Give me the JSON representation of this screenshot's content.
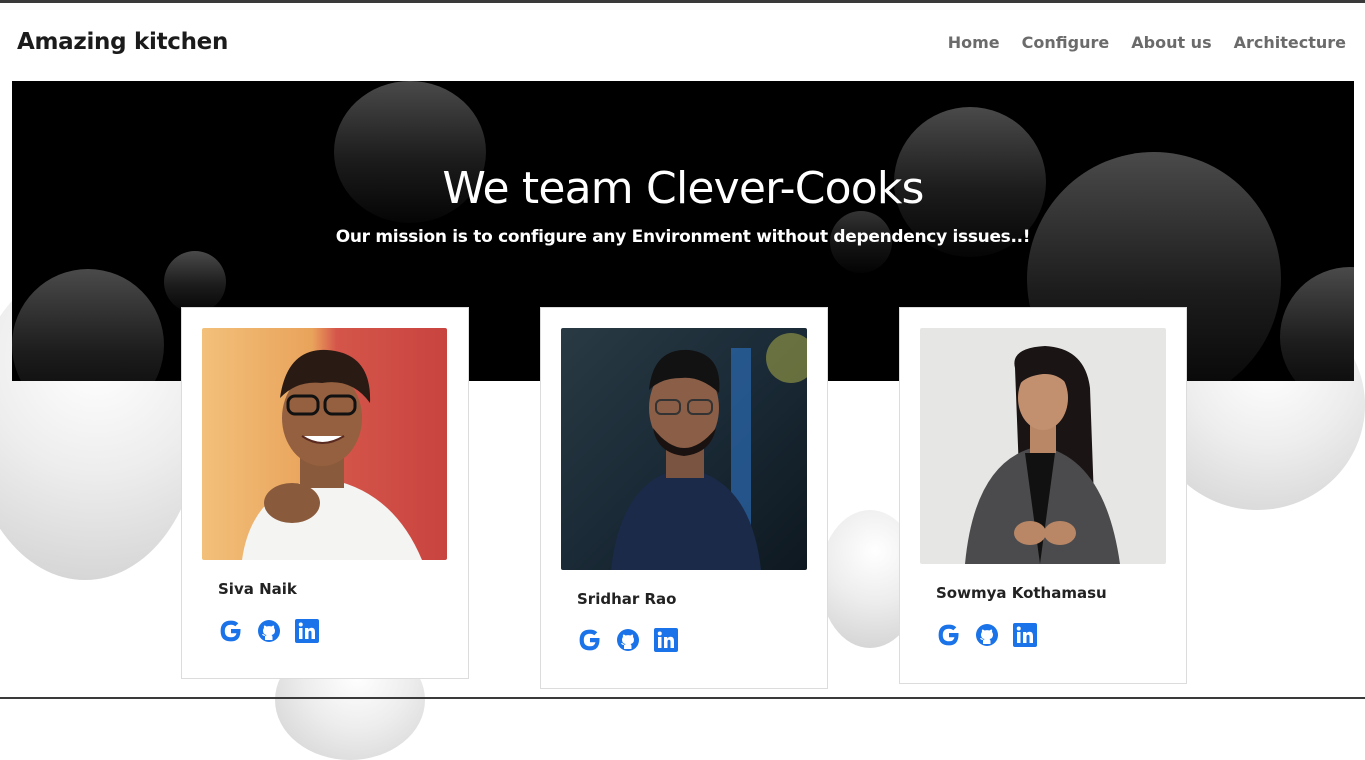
{
  "brand": {
    "title": "Amazing kitchen"
  },
  "nav": {
    "items": [
      {
        "label": "Home"
      },
      {
        "label": "Configure"
      },
      {
        "label": "About us"
      },
      {
        "label": "Architecture"
      }
    ]
  },
  "hero": {
    "title": "We team Clever-Cooks",
    "subtitle": "Our mission is to configure any Environment without dependency issues..!"
  },
  "team": [
    {
      "name": "Siva Naik",
      "socials": [
        "google-icon",
        "github-icon",
        "linkedin-icon"
      ]
    },
    {
      "name": "Sridhar Rao",
      "socials": [
        "google-icon",
        "github-icon",
        "linkedin-icon"
      ]
    },
    {
      "name": "Sowmya Kothamasu",
      "socials": [
        "google-icon",
        "github-icon",
        "linkedin-icon"
      ]
    }
  ],
  "colors": {
    "accent": "#1a73e8",
    "hero_bg": "#000000",
    "nav_text": "#6b6b6b"
  }
}
